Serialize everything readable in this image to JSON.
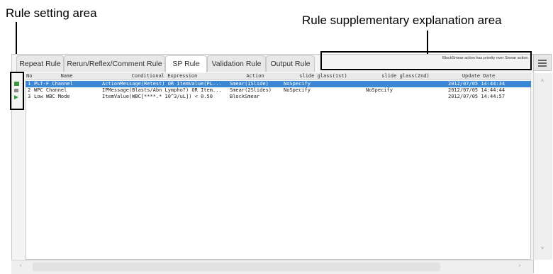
{
  "annotations": {
    "left_label": "Rule setting area",
    "right_label": "Rule supplementary explanation area"
  },
  "tabs": [
    {
      "label": "Repeat Rule"
    },
    {
      "label": "Rerun/Reflex/Comment Rule"
    },
    {
      "label": "SP Rule",
      "active": true
    },
    {
      "label": "Validation Rule"
    },
    {
      "label": "Output Rule"
    }
  ],
  "supplementary_text": "BlockSmear action has priority over Smear action.",
  "table": {
    "columns": [
      "No.",
      "Name",
      "Conditional Expression",
      "Action",
      "slide glass(1st)",
      "slide glass(2nd)",
      "Update Date"
    ],
    "rows": [
      {
        "marker_color": "#3b9a3b",
        "no": "1",
        "name": "PLT-F Channel",
        "expr": "ActionMessage(Retest) OR ItemValue(PL...",
        "action": "Smear(1Slide)",
        "g1": "NoSpecify",
        "g2": "",
        "date": "2012/07/05 14:44:34",
        "selected": true
      },
      {
        "marker_color": "#8a8a8a",
        "no": "2",
        "name": "WPC Channel",
        "expr": "IPMessage(Blasts/Abn Lympho?) OR Item...",
        "action": "Smear(2Slides)",
        "g1": "NoSpecify",
        "g2": "NoSpecify",
        "date": "2012/07/05 14:44:44",
        "selected": false
      },
      {
        "marker_color": "#3b9a3b",
        "no": "3",
        "name": "Low WBC Mode",
        "expr": "ItemValue(WBC[****.* 10^3/uL]) < 0.50",
        "action": "BlockSmear",
        "g1": "",
        "g2": "",
        "date": "2012/07/05 14:44:57",
        "selected": false
      }
    ]
  },
  "icons": [
    "menu-icon",
    "scroll-up-arrow-icon",
    "scroll-down-arrow-icon",
    "scroll-left-arrow-icon",
    "scroll-right-arrow-icon",
    "status-marker-icon"
  ],
  "colors": {
    "selection": "#3a87d6",
    "marker_active": "#3b9a3b",
    "marker_inactive": "#8a8a8a"
  }
}
